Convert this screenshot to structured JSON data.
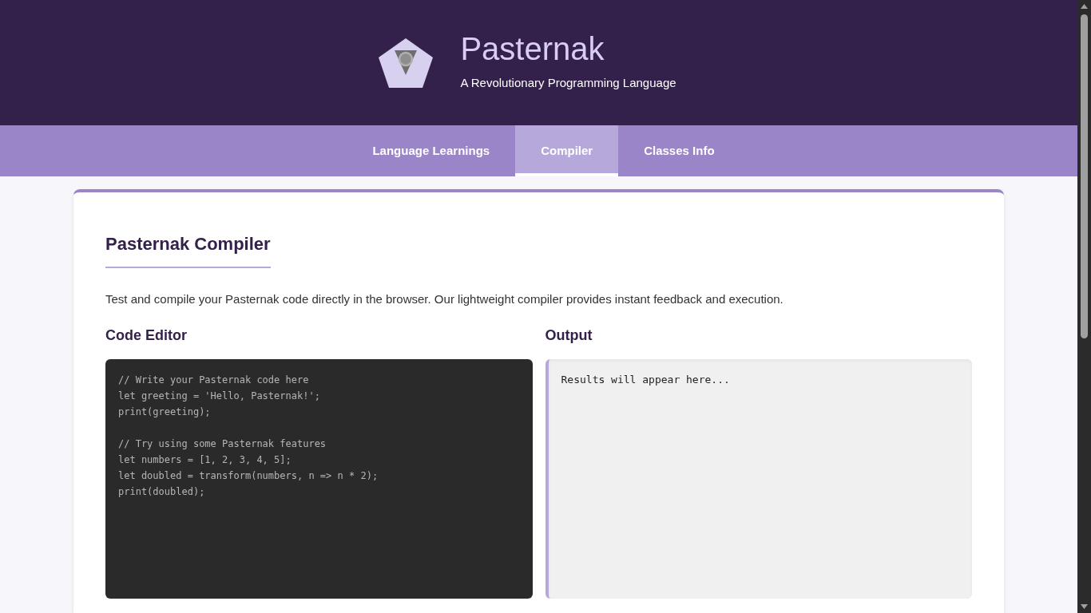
{
  "header": {
    "title": "Pasternak",
    "subtitle": "A Revolutionary Programming Language"
  },
  "tabs": [
    {
      "label": "Language Learnings",
      "selected": false
    },
    {
      "label": "Compiler",
      "selected": true
    },
    {
      "label": "Classes Info",
      "selected": false
    }
  ],
  "section": {
    "title": "Pasternak Compiler",
    "description": "Test and compile your Pasternak code directly in the browser. Our lightweight compiler provides instant feedback and execution."
  },
  "editor": {
    "title": "Code Editor",
    "code_blocks": [
      [
        "// Write your Pasternak code here",
        "let greeting = 'Hello, Pasternak!';",
        "print(greeting);"
      ],
      [
        "// Try using some Pasternak features",
        "let numbers = [1, 2, 3, 4, 5];",
        "let doubled = transform(numbers, n => n * 2);",
        "print(doubled);"
      ]
    ]
  },
  "output": {
    "title": "Output",
    "text": "Results will appear here..."
  }
}
